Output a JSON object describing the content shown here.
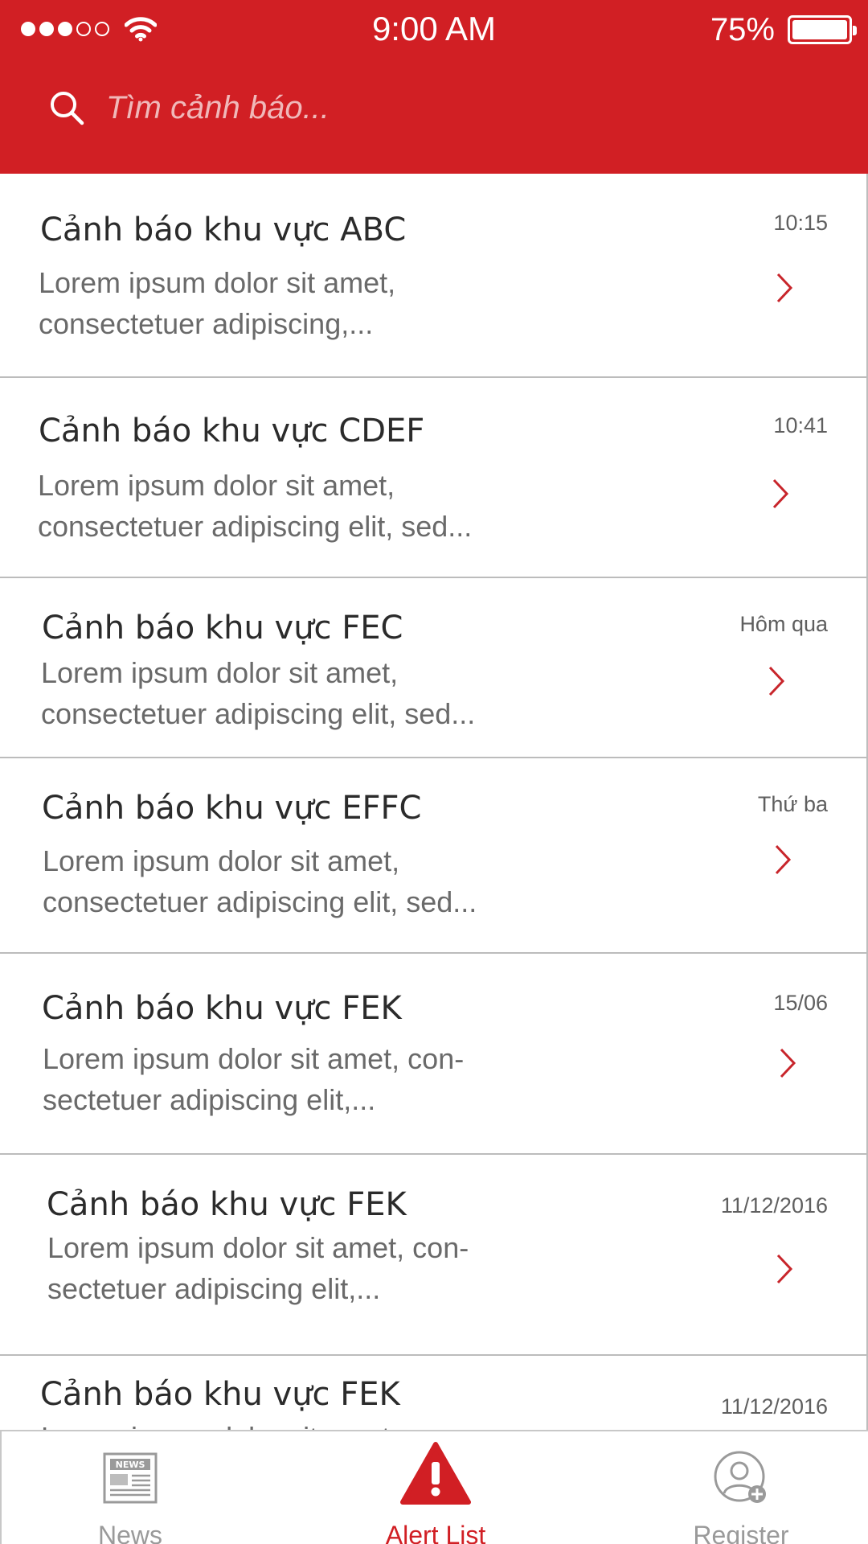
{
  "status_bar": {
    "time": "9:00 AM",
    "battery_percent": "75%",
    "signal_bars_filled": 3,
    "signal_bars_total": 5
  },
  "search": {
    "placeholder": "Tìm cảnh báo..."
  },
  "alerts": [
    {
      "title": "Cảnh báo khu vực ABC",
      "line1": "Lorem ipsum dolor sit amet,",
      "line2": "consectetuer adipiscing,...",
      "time": "10:15"
    },
    {
      "title": "Cảnh báo khu vực CDEF",
      "line1": "Lorem ipsum dolor sit amet,",
      "line2": "consectetuer adipiscing elit, sed...",
      "time": "10:41"
    },
    {
      "title": "Cảnh báo khu vực FEC",
      "line1": "Lorem ipsum dolor sit amet,",
      "line2": "consectetuer adipiscing elit, sed...",
      "time": "Hôm qua"
    },
    {
      "title": "Cảnh báo khu vực EFFC",
      "line1": "Lorem ipsum dolor sit amet,",
      "line2": "consectetuer adipiscing elit, sed...",
      "time": "Thứ ba"
    },
    {
      "title": "Cảnh báo khu vực FEK",
      "line1": "Lorem ipsum dolor sit amet, con-",
      "line2": "sectetuer adipiscing elit,...",
      "time": "15/06"
    },
    {
      "title": "Cảnh báo khu vực FEK",
      "line1": "Lorem ipsum dolor sit amet, con-",
      "line2": "sectetuer adipiscing elit,...",
      "time": "11/12/2016"
    },
    {
      "title": "Cảnh báo khu vực FEK",
      "line1": "Lorem ipsum dolor sit amet, con-",
      "line2": "",
      "time": "11/12/2016"
    }
  ],
  "tabs": {
    "news": {
      "label": "News",
      "icon": "newspaper-icon",
      "icon_text": "NEWS"
    },
    "alerts": {
      "label": "Alert List",
      "icon": "warning-icon"
    },
    "register": {
      "label": "Register",
      "icon": "user-add-icon"
    }
  },
  "colors": {
    "brand_red": "#d11f24",
    "tab_inactive": "#9a9a9a",
    "chevron": "#c8252b"
  }
}
